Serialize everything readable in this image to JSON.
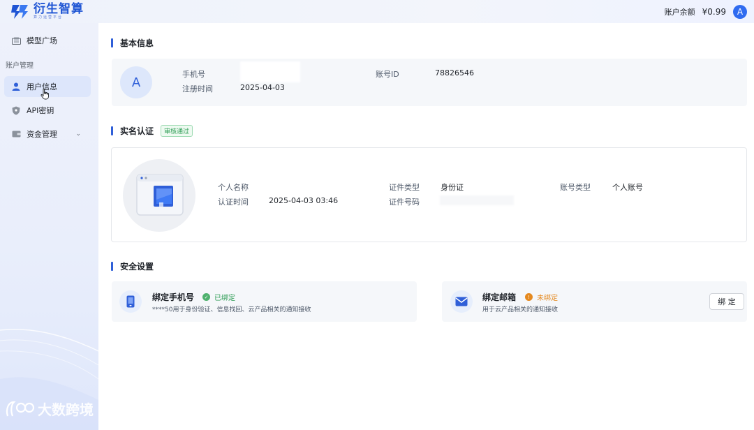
{
  "header": {
    "logo_title": "衍生智算",
    "logo_subtitle": "算力运营平台",
    "balance_label": "账户余额",
    "balance_value": "¥0.99",
    "avatar_letter": "A"
  },
  "sidebar": {
    "items": [
      {
        "label": "模型广场",
        "icon": "cube-icon"
      },
      {
        "label": "用户信息",
        "icon": "user-icon",
        "active": true
      },
      {
        "label": "API密钥",
        "icon": "shield-icon"
      },
      {
        "label": "资金管理",
        "icon": "wallet-icon"
      }
    ],
    "group_label": "账户管理",
    "watermark": "大数跨境"
  },
  "basic": {
    "title": "基本信息",
    "avatar_letter": "A",
    "phone_label": "手机号",
    "register_label": "注册时间",
    "register_value": "2025-04-03",
    "account_id_label": "账号ID",
    "account_id_value": "78826546"
  },
  "realname": {
    "title": "实名认证",
    "badge": "审核通过",
    "name_label": "个人名称",
    "time_label": "认证时间",
    "time_value": "2025-04-03 03:46",
    "cert_type_label": "证件类型",
    "cert_type_value": "身份证",
    "cert_no_label": "证件号码",
    "account_type_label": "账号类型",
    "account_type_value": "个人账号"
  },
  "security": {
    "title": "安全设置",
    "phone": {
      "title": "绑定手机号",
      "status": "已绑定",
      "desc": "****50用于身份验证、信息找回、云产品相关的通知接收"
    },
    "email": {
      "title": "绑定邮箱",
      "status": "未绑定",
      "desc": "用于云产品相关的通知接收",
      "button": "绑 定"
    }
  },
  "colors": {
    "brand": "#2f5fd8",
    "success": "#2e9d55",
    "warning": "#e5891e"
  }
}
